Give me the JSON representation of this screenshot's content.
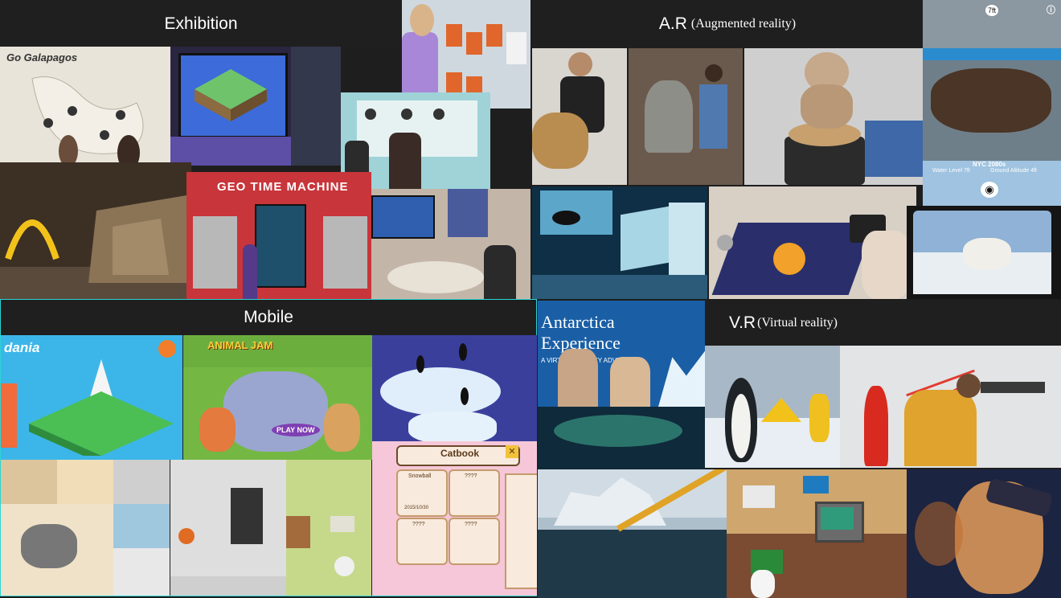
{
  "sections": {
    "exhibition": {
      "title": "Exhibition"
    },
    "ar": {
      "title_main": "A.R",
      "title_sub": "(Augmented reality)"
    },
    "mobile": {
      "title": "Mobile"
    },
    "vr": {
      "title_main": "V.R",
      "title_sub": "(Virtual reality)"
    }
  },
  "exhibition_photos": {
    "map_heading": "Go Galapagos",
    "geo_sign": "GEO TIME MACHINE"
  },
  "ar_photos": {
    "phone_top": "7ft",
    "nyc_title": "NYC 2080s",
    "water_level": "Water Level 7ft",
    "ground_alt": "Ground Altitude 4ft"
  },
  "mobile_photos": {
    "app_name": "dania",
    "game_logo": "ANIMAL JAM",
    "play_now": "PLAY NOW",
    "catbook_title": "Catbook",
    "card_name": "Snowball",
    "card_date": "2015/10/30",
    "unknown": "????"
  },
  "vr_photos": {
    "antarctica_line1": "Antarctica",
    "antarctica_line2": "Experience",
    "antarctica_sub": "A VIRTUAL REALITY ADVENTURE"
  },
  "colors": {
    "section_bar": "#1f1f1f",
    "mobile_frame": "#2bd4d4",
    "label_text": "#ffffff"
  }
}
